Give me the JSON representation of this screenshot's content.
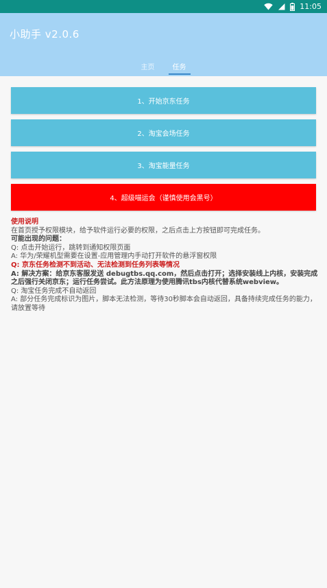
{
  "status_bar": {
    "time": "11:05"
  },
  "header": {
    "title": "小助手 v2.0.6"
  },
  "tabs": [
    {
      "label": "主页"
    },
    {
      "label": "任务"
    }
  ],
  "buttons": [
    {
      "label": "1、开始京东任务"
    },
    {
      "label": "2、淘宝会场任务"
    },
    {
      "label": "3、淘宝能量任务"
    },
    {
      "label": "4、超级喵运会（谨慎使用会黑号）"
    }
  ],
  "instructions": {
    "title": "使用说明",
    "intro": "在首页授予权限模块，给予软件运行必要的权限，之后点击上方按钮即可完成任务。",
    "problems_heading": "可能出现的问题：",
    "q1": "Q: 点击开始运行，跳转到通知权限页面",
    "a1": "A: 华为/荣耀机型需要在设置-应用管理内手动打开软件的悬浮窗权限",
    "q2": "Q: 京东任务检测不到活动、无法检测到任务列表等情况",
    "a2": "A: 解决方案：给京东客服发送 debugtbs.qq.com，然后点击打开；选择安装线上内核，安装完成之后强行关闭京东；运行任务尝试。此方法原理为使用腾讯tbs内核代替系统webview。",
    "q3": "Q: 淘宝任务完成不自动返回",
    "a3": "A: 部分任务完成标识为图片，脚本无法检测，等待30秒脚本会自动返回，具备持续完成任务的能力，请放置等待"
  },
  "colors": {
    "status_bar": "#0e8f86",
    "header": "#a5d4f5",
    "button_blue": "#5ac0dc",
    "button_red": "#ff0000",
    "warning_text": "#cc1f1f"
  }
}
